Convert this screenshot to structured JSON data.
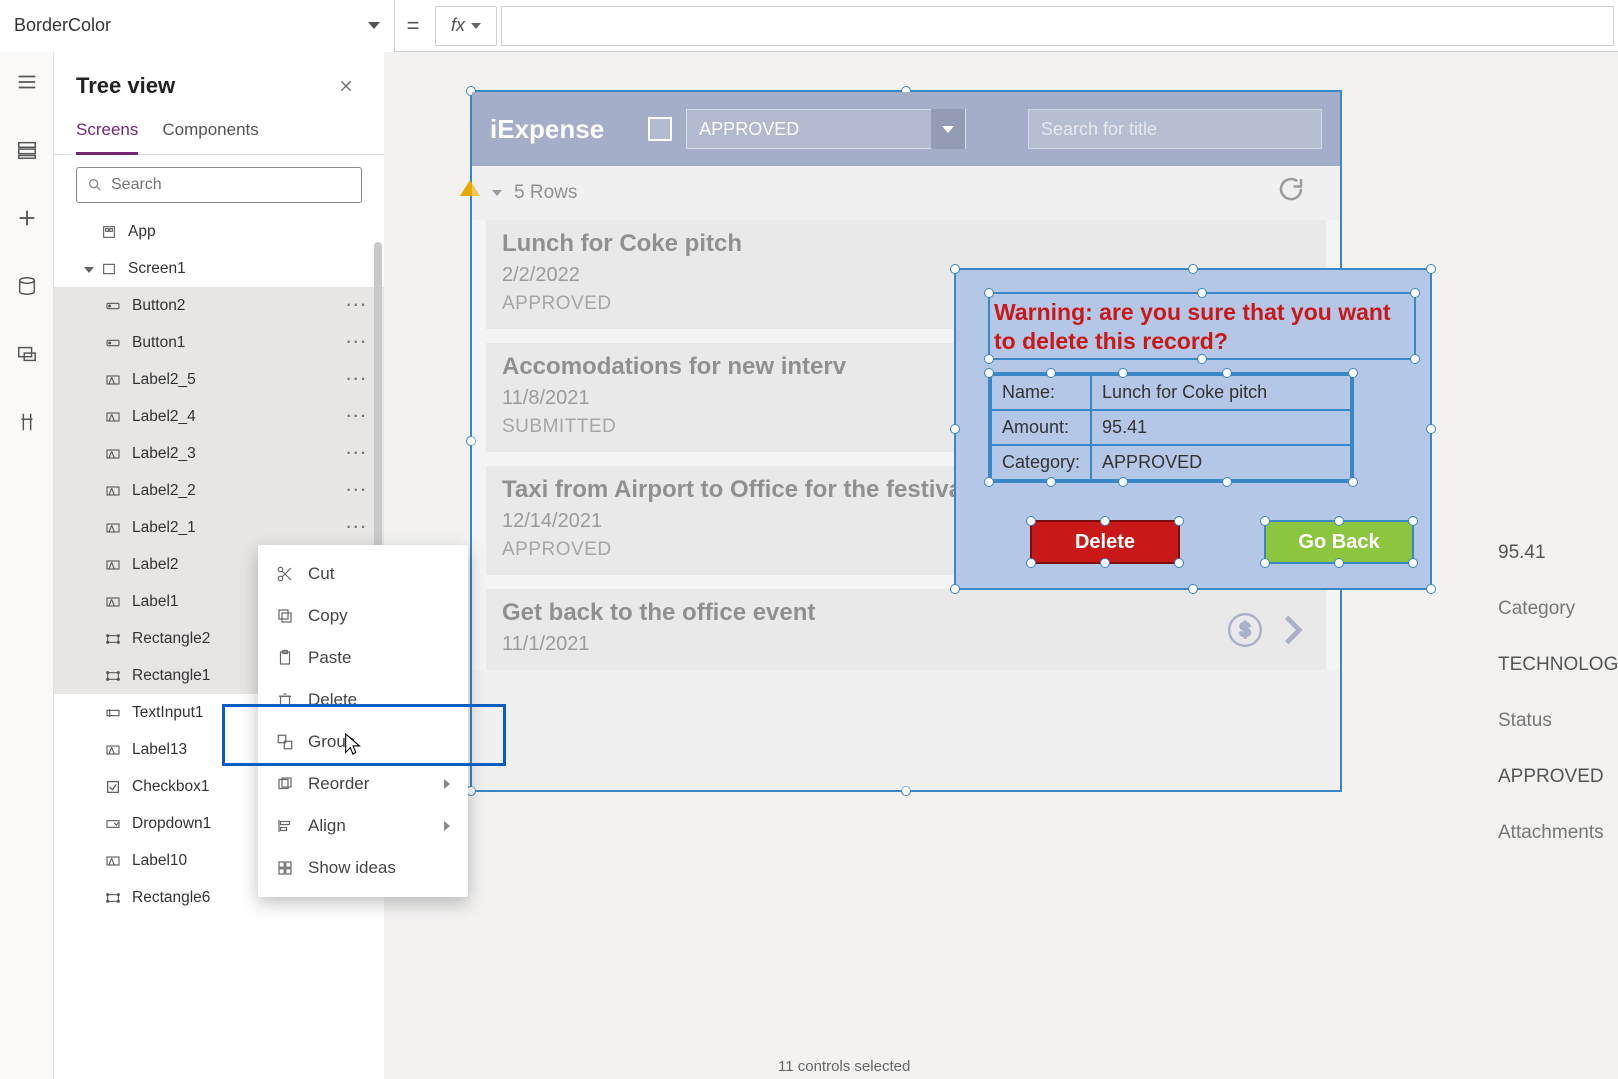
{
  "property_dropdown": "BorderColor",
  "equals": "=",
  "fx": "fx",
  "tree": {
    "title": "Tree view",
    "tabs": {
      "screens": "Screens",
      "components": "Components"
    },
    "search_placeholder": "Search",
    "app": "App",
    "screen": "Screen1",
    "items": [
      {
        "name": "Button2",
        "icon": "button",
        "sel": true
      },
      {
        "name": "Button1",
        "icon": "button",
        "sel": true
      },
      {
        "name": "Label2_5",
        "icon": "label",
        "sel": true
      },
      {
        "name": "Label2_4",
        "icon": "label",
        "sel": true
      },
      {
        "name": "Label2_3",
        "icon": "label",
        "sel": true
      },
      {
        "name": "Label2_2",
        "icon": "label",
        "sel": true
      },
      {
        "name": "Label2_1",
        "icon": "label",
        "sel": true
      },
      {
        "name": "Label2",
        "icon": "label",
        "sel": true
      },
      {
        "name": "Label1",
        "icon": "label",
        "sel": true
      },
      {
        "name": "Rectangle2",
        "icon": "rect",
        "sel": true
      },
      {
        "name": "Rectangle1",
        "icon": "rect",
        "sel": true
      },
      {
        "name": "TextInput1",
        "icon": "textinput",
        "sel": false
      },
      {
        "name": "Label13",
        "icon": "label",
        "sel": false
      },
      {
        "name": "Checkbox1",
        "icon": "checkbox",
        "sel": false
      },
      {
        "name": "Dropdown1",
        "icon": "dropdown",
        "sel": false
      },
      {
        "name": "Label10",
        "icon": "label",
        "sel": false
      },
      {
        "name": "Rectangle6",
        "icon": "rect",
        "sel": false
      }
    ]
  },
  "ctx": {
    "cut": "Cut",
    "copy": "Copy",
    "paste": "Paste",
    "delete": "Delete",
    "group": "Group",
    "reorder": "Reorder",
    "align": "Align",
    "show_ideas": "Show ideas"
  },
  "app": {
    "title": "iExpense",
    "dropdown_value": "APPROVED",
    "search_placeholder": "Search for title",
    "rows_label": "5 Rows",
    "cards": [
      {
        "title": "Lunch for Coke pitch",
        "date": "2/2/2022",
        "status": "APPROVED"
      },
      {
        "title": "Accomodations for new interv",
        "date": "11/8/2021",
        "status": "SUBMITTED"
      },
      {
        "title": "Taxi from Airport to Office for the festival",
        "date": "12/14/2021",
        "status": "APPROVED"
      },
      {
        "title": "Get back to the office event",
        "date": "11/1/2021",
        "status": ""
      }
    ],
    "dialog": {
      "warning": "Warning: are you sure that you want to delete this record?",
      "name_lbl": "Name:",
      "name_val": "Lunch for Coke pitch",
      "amount_lbl": "Amount:",
      "amount_val": "95.41",
      "category_lbl": "Category:",
      "category_val": "APPROVED",
      "delete_btn": "Delete",
      "goback_btn": "Go Back"
    },
    "detail": {
      "amount_val": "95.41",
      "category_lbl": "Category",
      "category_val": "TECHNOLOGY",
      "status_lbl": "Status",
      "status_val": "APPROVED",
      "attachments_lbl": "Attachments"
    }
  },
  "status_text": "11 controls selected"
}
